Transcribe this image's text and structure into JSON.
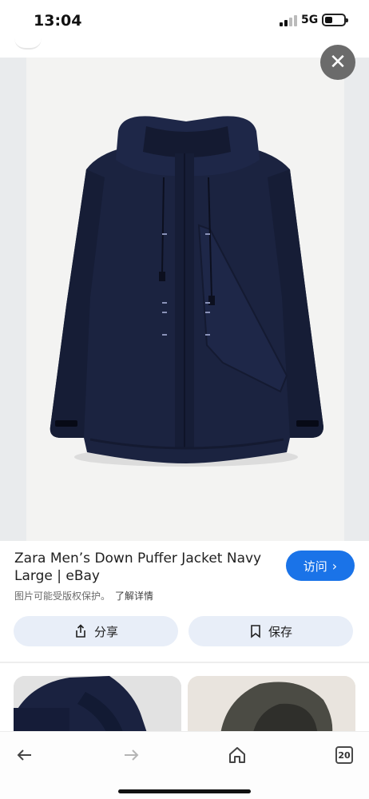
{
  "status_bar": {
    "time": "13:04",
    "network": "5G"
  },
  "product": {
    "title_line1": "Zara Men’s Down Puffer Jacket Navy",
    "title_line2": "Large | eBay",
    "copyright_note": "图片可能受版权保护。",
    "learn_more": "了解详情"
  },
  "actions": {
    "visit_label": "访问",
    "visit_chevron": "›",
    "share_label": "分享",
    "save_label": "保存"
  },
  "close_glyph": "✕",
  "bottom_nav": {
    "back_glyph": "←",
    "forward_glyph": "→",
    "tab_count": "20"
  },
  "colors": {
    "accent": "#1a73e8",
    "jacket": "#1b2340",
    "pill_bg": "#e8eef8"
  },
  "icons": [
    "close-icon",
    "share-icon",
    "bookmark-icon",
    "back-arrow-icon",
    "forward-arrow-icon",
    "home-icon",
    "tabs-icon",
    "signal-icon",
    "battery-icon"
  ]
}
